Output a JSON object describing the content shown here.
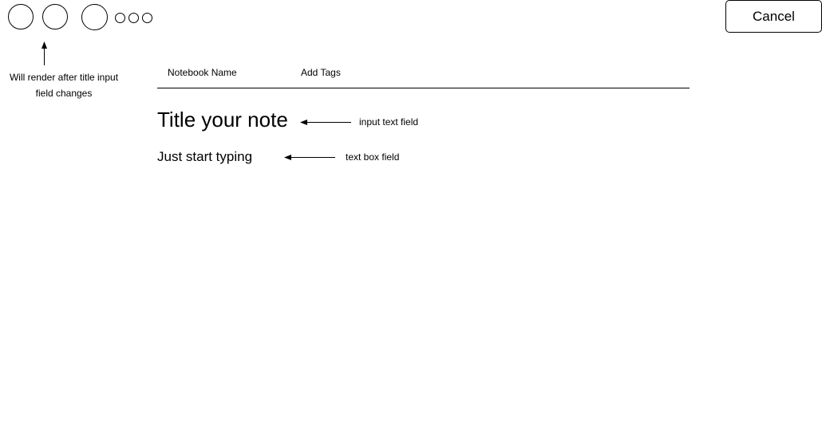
{
  "toolbar": {
    "large_circles": [
      "circle-icon",
      "circle-icon",
      "circle-icon"
    ],
    "small_circles": [
      "circle-icon",
      "circle-icon",
      "circle-icon"
    ],
    "cancel_label": "Cancel"
  },
  "annotations": {
    "toolbar_note": "Will render after title input field changes",
    "title_field_note": "input text field",
    "body_field_note": "text box field"
  },
  "meta": {
    "notebook_label": "Notebook Name",
    "tags_label": "Add Tags"
  },
  "editor": {
    "title_placeholder": "Title your note",
    "body_placeholder": "Just start typing"
  }
}
